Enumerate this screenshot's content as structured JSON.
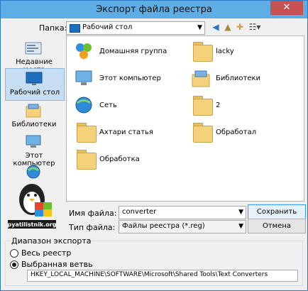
{
  "window": {
    "title": "Экспорт файла реестра",
    "close_glyph": "✕"
  },
  "toolbar": {
    "folder_label": "Папка:",
    "folder_value": "Рабочий стол",
    "icons": [
      "back-icon",
      "up-folder-icon",
      "new-folder-icon",
      "view-menu-icon"
    ]
  },
  "places": [
    {
      "label": "Недавние места",
      "icon": "recent-places-icon",
      "selected": false
    },
    {
      "label": "Рабочий стол",
      "icon": "desktop-icon",
      "selected": true
    },
    {
      "label": "Библиотеки",
      "icon": "libraries-icon",
      "selected": false
    },
    {
      "label": "Этот компьютер",
      "icon": "computer-icon",
      "selected": false
    },
    {
      "label": "",
      "icon": "network-icon",
      "selected": false
    }
  ],
  "items": [
    {
      "label": "Домашняя группа",
      "icon": "homegroup-icon"
    },
    {
      "label": "lacky",
      "icon": "user-folder-icon"
    },
    {
      "label": "Этот компьютер",
      "icon": "computer-icon"
    },
    {
      "label": "Библиотеки",
      "icon": "libraries-icon"
    },
    {
      "label": "Сеть",
      "icon": "network-icon"
    },
    {
      "label": "2",
      "icon": "folder-icon"
    },
    {
      "label": "Ахтари статья",
      "icon": "folder-icon"
    },
    {
      "label": "Обработал",
      "icon": "folder-icon"
    },
    {
      "label": "Обработка",
      "icon": "folder-icon"
    }
  ],
  "file": {
    "name_label": "Имя файла:",
    "name_value": "converter",
    "type_label": "Тип файла:",
    "type_value": "Файлы реестра (*.reg)",
    "save_label": "Сохранить",
    "cancel_label": "Отмена"
  },
  "export_range": {
    "legend": "Диапазон экспорта",
    "option_all": "Весь реестр",
    "option_branch": "Выбранная ветвь",
    "branch_path": "HKEY_LOCAL_MACHINE\\SOFTWARE\\Microsoft\\Shared Tools\\Text Converters",
    "selected": "branch"
  },
  "watermark": {
    "text": "pyatilistnik.org"
  },
  "colors": {
    "titlebar": "#5eaee5",
    "close": "#c75050",
    "selection": "#c7ddf2"
  }
}
